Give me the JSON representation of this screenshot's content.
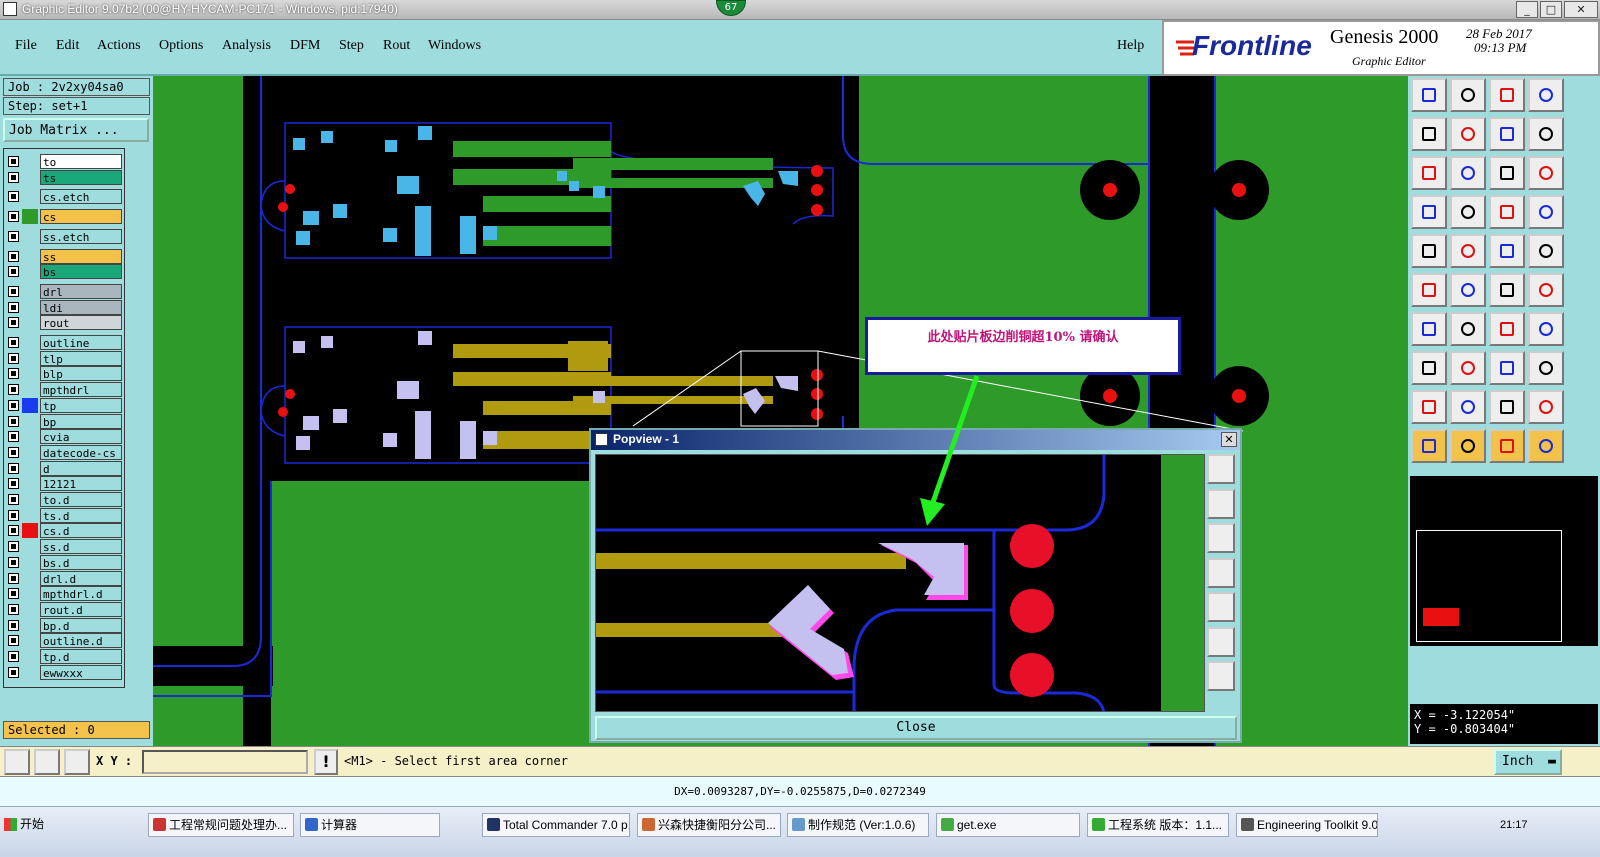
{
  "window": {
    "title": "Graphic Editor 9.07b2 (00@HY-HYCAM-PC171 - Windows, pid:17940)",
    "badge": "67"
  },
  "menu": [
    "File",
    "Edit",
    "Actions",
    "Options",
    "Analysis",
    "DFM",
    "Step",
    "Rout",
    "Windows"
  ],
  "help": "Help",
  "brand": {
    "logo": "Frontline",
    "product": "Genesis 2000",
    "sub": "Graphic Editor",
    "date": "28 Feb 2017",
    "time": "09:13 PM"
  },
  "job": {
    "job_label": "Job : 2v2xy04sa0",
    "step_label": "Step: set+1",
    "matrix_button": "Job Matrix ..."
  },
  "layers": [
    {
      "name": "to",
      "color": "#ffffff"
    },
    {
      "name": "ts",
      "color": "#1aa87a"
    },
    {
      "name": "cs.etch",
      "color": "#9fdcde"
    },
    {
      "name": "cs",
      "color": "#f3c24a",
      "swatch": "#2d9a2a"
    },
    {
      "name": "ss.etch",
      "color": "#9fdcde"
    },
    {
      "name": "ss",
      "color": "#f3c24a"
    },
    {
      "name": "bs",
      "color": "#1aa87a"
    },
    {
      "name": "drl",
      "color": "#a9b6bd"
    },
    {
      "name": "ldi",
      "color": "#a9b6bd"
    },
    {
      "name": "rout",
      "color": "#cfd5d8"
    },
    {
      "name": "outline",
      "color": "#9fdcde"
    },
    {
      "name": "tlp",
      "color": "#9fdcde"
    },
    {
      "name": "blp",
      "color": "#9fdcde"
    },
    {
      "name": "mpthdrl",
      "color": "#9fdcde"
    },
    {
      "name": "tp",
      "color": "#9fdcde",
      "swatch": "#1a3cf0"
    },
    {
      "name": "bp",
      "color": "#9fdcde"
    },
    {
      "name": "cvia",
      "color": "#9fdcde"
    },
    {
      "name": "datecode-cs",
      "color": "#9fdcde"
    },
    {
      "name": "d",
      "color": "#9fdcde"
    },
    {
      "name": "12121",
      "color": "#9fdcde"
    },
    {
      "name": "to.d",
      "color": "#9fdcde"
    },
    {
      "name": "ts.d",
      "color": "#9fdcde"
    },
    {
      "name": "cs.d",
      "color": "#9fdcde",
      "swatch": "#e81010"
    },
    {
      "name": "ss.d",
      "color": "#9fdcde"
    },
    {
      "name": "bs.d",
      "color": "#9fdcde"
    },
    {
      "name": "drl.d",
      "color": "#9fdcde"
    },
    {
      "name": "mpthdrl.d",
      "color": "#9fdcde"
    },
    {
      "name": "rout.d",
      "color": "#9fdcde"
    },
    {
      "name": "bp.d",
      "color": "#9fdcde"
    },
    {
      "name": "outline.d",
      "color": "#9fdcde"
    },
    {
      "name": "tp.d",
      "color": "#9fdcde"
    },
    {
      "name": "ewwxxx",
      "color": "#9fdcde"
    }
  ],
  "selected": "Selected : 0",
  "annotation": "此处贴片板边削铜超10%   请确认",
  "popview": {
    "title": "Popview - 1",
    "close_button": "Close"
  },
  "coords": {
    "x": "X = -3.122054\"",
    "y": "Y = -0.803404\""
  },
  "command": {
    "xy_label": "X Y :",
    "xy_value": "",
    "prompt": "<M1> - Select first area corner",
    "units": "Inch"
  },
  "status": "DX=0.0093287,DY=-0.0255875,D=0.0272349",
  "taskbar": {
    "start": "开始",
    "items": [
      "工程常规问题处理办...",
      "计算器",
      "Total Commander 7.0 p...",
      "兴森快捷衡阳分公司...",
      "制作规范 (Ver:1.0.6)",
      "get.exe",
      "工程系统  版本：1.1...",
      "Engineering Toolkit 9.0..."
    ],
    "time": "21:17"
  },
  "colors": {
    "panel": "#9fdcde",
    "copper": "#2d9a2a",
    "pad_lavender": "#c4c0f0",
    "annotation_text": "#c0147a",
    "arrow": "#22ee22"
  }
}
